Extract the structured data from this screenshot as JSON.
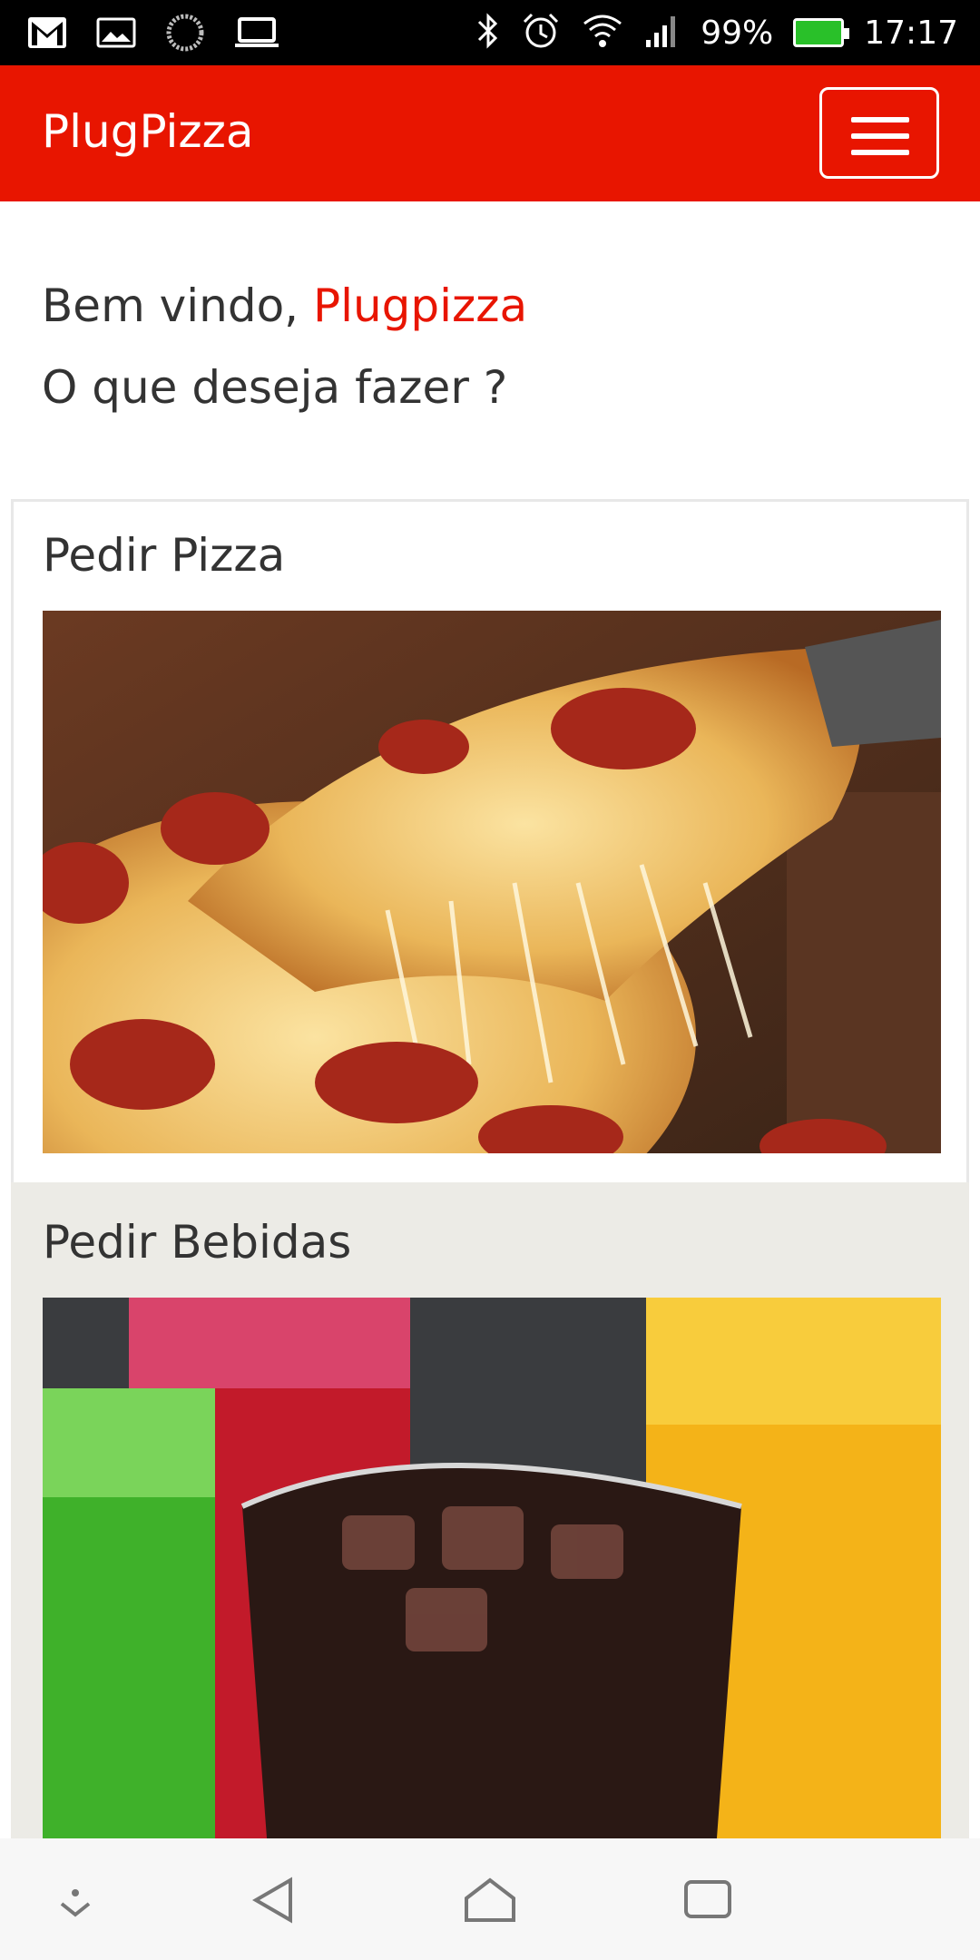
{
  "status_bar": {
    "battery": "99%",
    "time": "17:17"
  },
  "app_bar": {
    "title": "PlugPizza"
  },
  "welcome": {
    "greeting": "Bem vindo, ",
    "user": "Plugpizza",
    "question": "O que deseja fazer ?"
  },
  "cards": [
    {
      "title": "Pedir Pizza"
    },
    {
      "title": "Pedir Bebidas"
    }
  ],
  "colors": {
    "brand": "#e81500",
    "text": "#333333",
    "card_alt_bg": "#ecebe6"
  },
  "nav": {
    "icons": [
      "notification-down-icon",
      "back-icon",
      "home-icon",
      "recents-icon"
    ]
  }
}
